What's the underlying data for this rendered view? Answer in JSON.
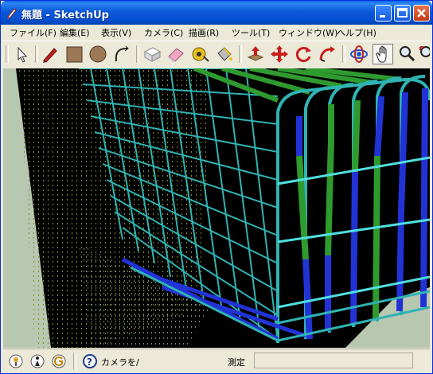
{
  "window": {
    "title": "無題 - SketchUp"
  },
  "menu": [
    {
      "label": "ファイル(F)"
    },
    {
      "label": "編集(E)"
    },
    {
      "label": "表示(V)"
    },
    {
      "label": "カメラ(C)"
    },
    {
      "label": "描画(R)"
    },
    {
      "label": "ツール(T)"
    },
    {
      "label": "ウィンドウ(W)"
    },
    {
      "label": "ヘルプ(H)"
    }
  ],
  "toolbar": {
    "tools": [
      "select-icon",
      "pencil-icon",
      "rectangle-icon",
      "circle-icon",
      "arc-icon",
      "push-pull-ghost-icon",
      "eraser-icon",
      "tape-measure-icon",
      "paint-bucket-icon",
      "push-pull-icon",
      "move-icon",
      "rotate-icon",
      "follow-me-icon",
      "orbit-icon",
      "pan-icon",
      "zoom-icon",
      "zoom-extents-icon"
    ],
    "active_tool": "pan-icon"
  },
  "status": {
    "hint": "カメラを/",
    "measure_label": "測定"
  },
  "colors": {
    "title_blue": "#0a58d8",
    "rebar_cyan": "#2fb3b3",
    "rebar_green": "#2f9a2f",
    "rebar_blue": "#2233d6",
    "ground": "#b7c7b0"
  }
}
